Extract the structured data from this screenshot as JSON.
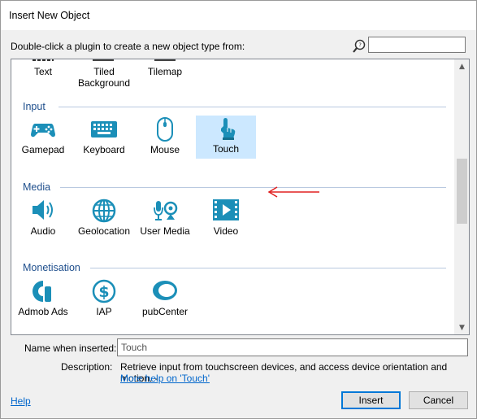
{
  "window": {
    "title": "Insert New Object"
  },
  "instruction": "Double-click a plugin to create a new object type from:",
  "search": {
    "value": "",
    "icon": "magnifier-icon"
  },
  "top_row": [
    {
      "label": "Text",
      "icon": "text-icon"
    },
    {
      "label": "Tiled\nBackground",
      "icon": "tiled-background-icon"
    },
    {
      "label": "Tilemap",
      "icon": "tilemap-icon"
    }
  ],
  "sections": [
    {
      "title": "Input",
      "items": [
        {
          "label": "Gamepad",
          "icon": "gamepad-icon"
        },
        {
          "label": "Keyboard",
          "icon": "keyboard-icon"
        },
        {
          "label": "Mouse",
          "icon": "mouse-icon"
        },
        {
          "label": "Touch",
          "icon": "touch-icon",
          "selected": true
        }
      ]
    },
    {
      "title": "Media",
      "items": [
        {
          "label": "Audio",
          "icon": "speaker-icon"
        },
        {
          "label": "Geolocation",
          "icon": "globe-icon"
        },
        {
          "label": "User Media",
          "icon": "webcam-microphone-icon"
        },
        {
          "label": "Video",
          "icon": "film-play-icon"
        }
      ]
    },
    {
      "title": "Monetisation",
      "items": [
        {
          "label": "Admob Ads",
          "icon": "admob-icon"
        },
        {
          "label": "IAP",
          "icon": "dollar-coin-icon"
        },
        {
          "label": "pubCenter",
          "icon": "pubcenter-icon"
        }
      ]
    }
  ],
  "name_when_inserted": {
    "label": "Name when inserted:",
    "value": "Touch"
  },
  "description": {
    "label": "Description:",
    "text": "Retrieve input from touchscreen devices, and access device orientation and motion. -",
    "link": "More help on 'Touch'"
  },
  "footer": {
    "help": "Help",
    "insert": "Insert",
    "cancel": "Cancel"
  },
  "colors": {
    "icon": "#1b8fb8",
    "section": "#1e4e8c",
    "selection": "#cce8ff",
    "annotation_arrow": "#e02020"
  }
}
